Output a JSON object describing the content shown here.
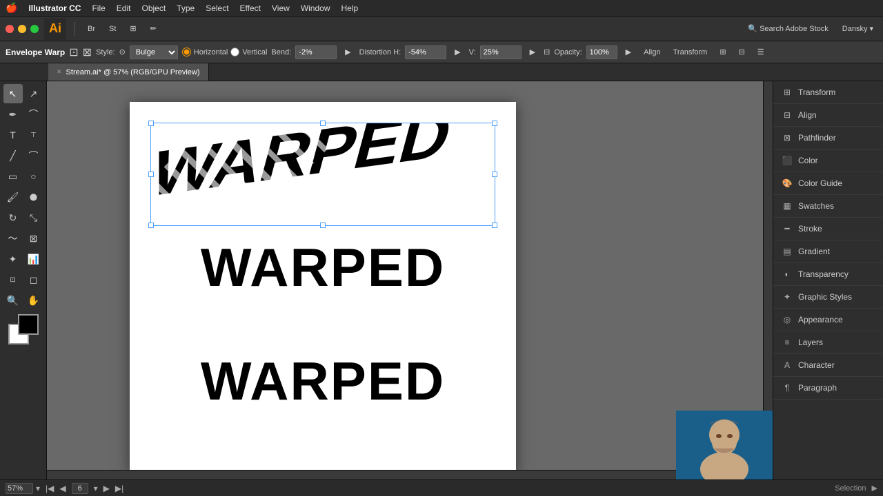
{
  "app": {
    "name": "Illustrator CC",
    "logo": "Ai"
  },
  "menu": {
    "apple": "🍎",
    "items": [
      "Illustrator CC",
      "File",
      "Edit",
      "Object",
      "Type",
      "Select",
      "Effect",
      "View",
      "Window",
      "Help"
    ]
  },
  "traffic_lights": {
    "close": "close",
    "minimize": "minimize",
    "maximize": "maximize"
  },
  "toolbar": {
    "items": [
      "bridge",
      "stock",
      "libraries",
      "paintbrush"
    ],
    "right_items": [
      "user",
      "Dansky",
      "search_stock"
    ],
    "search_placeholder": "Search Adobe Stock",
    "user_name": "Dansky"
  },
  "context_bar": {
    "tool_name": "Envelope Warp",
    "style_label": "Style:",
    "style_value": "Bulge",
    "horizontal_label": "Horizontal",
    "vertical_label": "Vertical",
    "bend_label": "Bend:",
    "bend_value": "-2%",
    "distortion_label": "Distortion H:",
    "distortion_h": "-54%",
    "distortion_v_label": "V:",
    "distortion_v": "25%",
    "opacity_label": "Opacity:",
    "opacity_value": "100%",
    "align_label": "Align",
    "transform_label": "Transform"
  },
  "tabs": [
    {
      "label": "Stream.ai* @ 57% (RGB/GPU Preview)",
      "active": true
    }
  ],
  "canvas": {
    "zoom": "57%",
    "artboard_label": "Stream.ai",
    "page_indicator": "6"
  },
  "warped_text": "WARPED",
  "normal_text_1": "WARPED",
  "normal_text_2": "WARPED",
  "right_panel": {
    "items": [
      {
        "icon": "transform-icon",
        "label": "Transform"
      },
      {
        "icon": "align-icon",
        "label": "Align"
      },
      {
        "icon": "pathfinder-icon",
        "label": "Pathfinder"
      },
      {
        "icon": "color-icon",
        "label": "Color"
      },
      {
        "icon": "color-guide-icon",
        "label": "Color Guide"
      },
      {
        "icon": "swatches-icon",
        "label": "Swatches"
      },
      {
        "icon": "stroke-icon",
        "label": "Stroke"
      },
      {
        "icon": "gradient-icon",
        "label": "Gradient"
      },
      {
        "icon": "transparency-icon",
        "label": "Transparency"
      },
      {
        "icon": "graphic-styles-icon",
        "label": "Graphic Styles"
      },
      {
        "icon": "appearance-icon",
        "label": "Appearance"
      },
      {
        "icon": "layers-icon",
        "label": "Layers"
      },
      {
        "icon": "character-icon",
        "label": "Character"
      },
      {
        "icon": "paragraph-icon",
        "label": "Paragraph"
      }
    ]
  },
  "status_bar": {
    "zoom": "57%",
    "page": "6",
    "tool_name": "Selection"
  }
}
